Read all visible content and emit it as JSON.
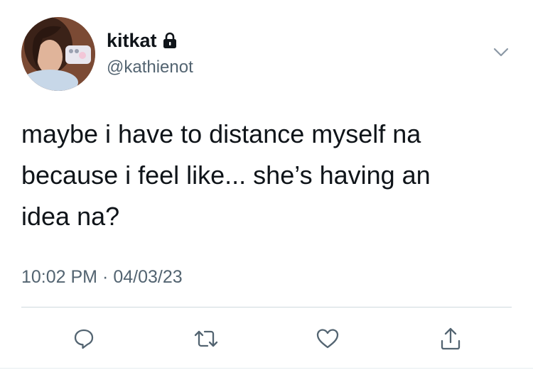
{
  "user": {
    "display_name": "kitkat",
    "handle": "@kathienot",
    "avatar_icon": "profile-photo",
    "protected_icon": "lock-icon"
  },
  "tweet": {
    "text": "maybe i have to distance myself na\nbecause i feel like... she’s having an\nidea na?",
    "time": "10:02 PM",
    "separator": "·",
    "date": "04/03/23"
  },
  "menu": {
    "icon": "chevron-down-icon"
  },
  "actions": [
    {
      "name": "reply",
      "icon": "reply-icon"
    },
    {
      "name": "retweet",
      "icon": "retweet-icon"
    },
    {
      "name": "like",
      "icon": "heart-icon"
    },
    {
      "name": "share",
      "icon": "share-icon"
    }
  ],
  "colors": {
    "text_primary": "#0f1419",
    "text_secondary": "#536471",
    "divider": "#cfd9de",
    "icon": "#536471"
  }
}
